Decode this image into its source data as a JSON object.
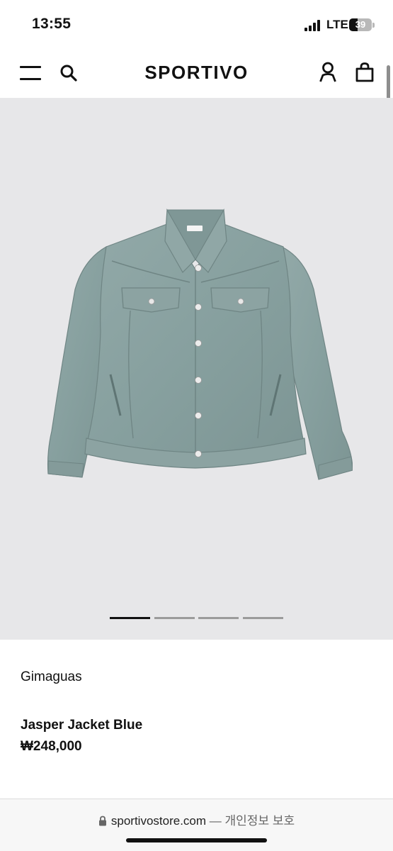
{
  "status_bar": {
    "time": "13:55",
    "network": "LTE",
    "battery": "39",
    "battery_level": 0.39
  },
  "header": {
    "logo": "SPORTIVO",
    "icons": [
      "menu-icon",
      "search-icon",
      "account-icon",
      "bag-icon"
    ]
  },
  "gallery": {
    "image": "denim-jacket",
    "slide_count": 4,
    "active_slide": 1
  },
  "product": {
    "brand": "Gimaguas",
    "name": "Jasper Jacket Blue",
    "price": "₩248,000"
  },
  "browser": {
    "url": "sportivostore.com",
    "separator": "—",
    "privacy_label": "개인정보 보호"
  },
  "colors": {
    "gallery_background": "#e7e7e9",
    "jacket": "#8aa1a0",
    "active_indicator": "#111111",
    "inactive_indicator": "#9b9b9b"
  }
}
